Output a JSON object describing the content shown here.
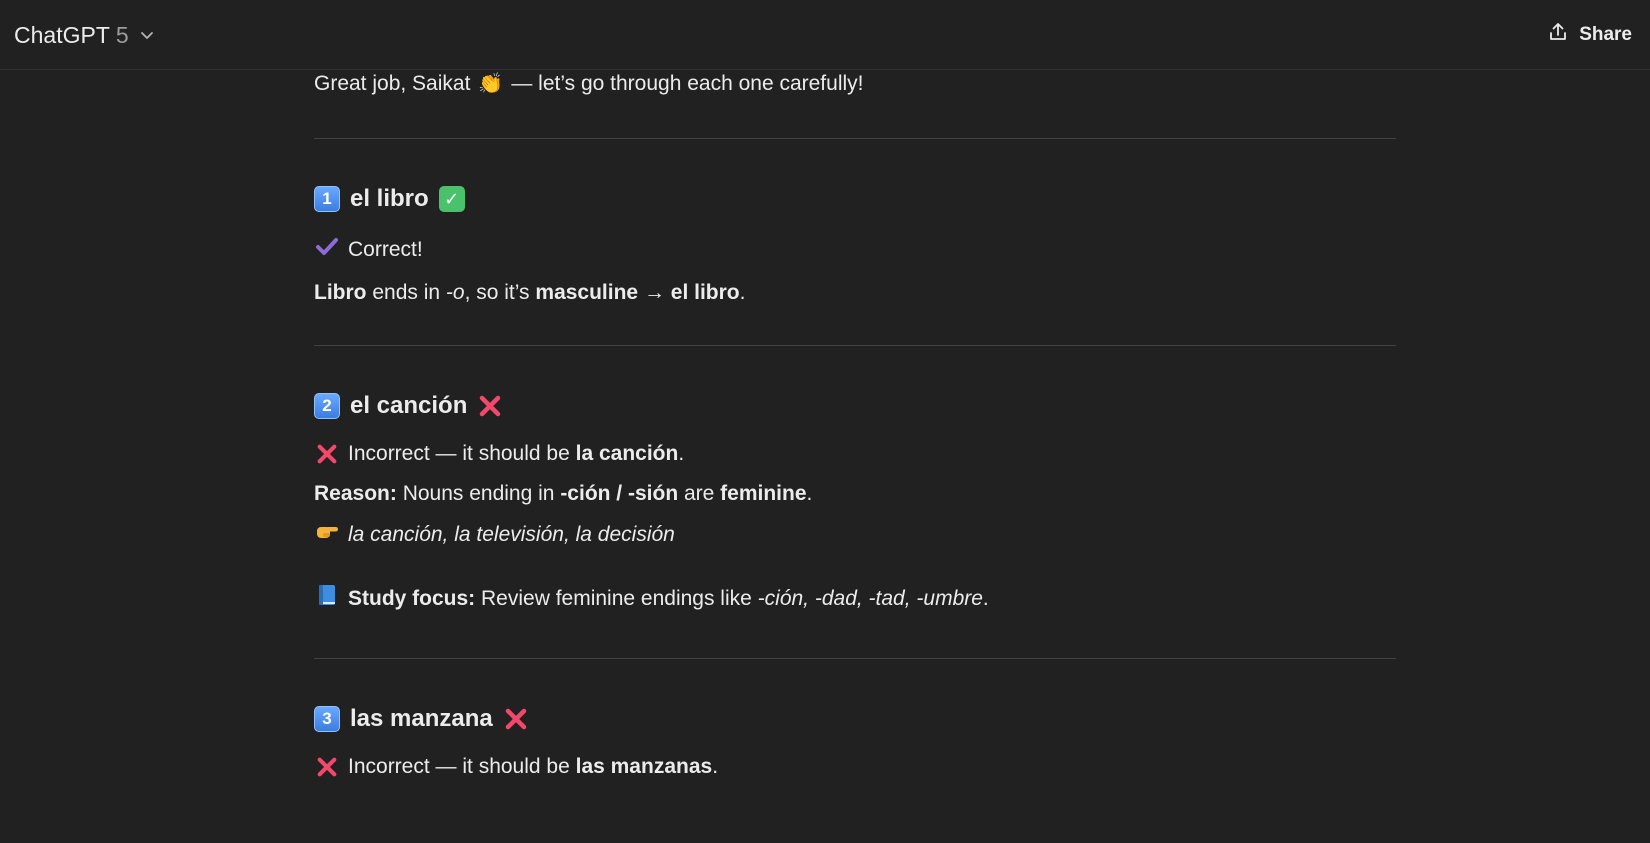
{
  "header": {
    "model_name": "ChatGPT",
    "model_version": "5",
    "share_label": "Share"
  },
  "message": {
    "intro_before": "Great job, Saikat",
    "intro_emoji": "👏",
    "intro_after": "— let’s go through each one carefully!",
    "items": [
      {
        "number": "1",
        "title": "el libro",
        "verdict": "Correct!",
        "explain_bold1": "Libro",
        "explain_mid1": " ends in ",
        "explain_em1": "-o",
        "explain_mid2": ", so it’s ",
        "explain_bold2": "masculine → el libro",
        "explain_end": "."
      },
      {
        "number": "2",
        "title": "el canción",
        "verdict_prefix": "Incorrect — it should be ",
        "verdict_bold": "la canción",
        "verdict_end": ".",
        "reason_label": "Reason:",
        "reason_mid1": " Nouns ending in ",
        "reason_bold1": "-ción / -sión",
        "reason_mid2": " are ",
        "reason_bold2": "feminine",
        "reason_end": ".",
        "examples": "la canción, la televisión, la decisión",
        "study_label": "Study focus:",
        "study_mid": " Review feminine endings like ",
        "study_em": "-ción, -dad, -tad, -umbre",
        "study_end": "."
      },
      {
        "number": "3",
        "title": "las manzana",
        "verdict_prefix": "Incorrect — it should be ",
        "verdict_bold": "las manzanas",
        "verdict_end": "."
      }
    ]
  },
  "colors": {
    "background": "#212121",
    "text": "#ececec",
    "divider": "#424242",
    "keycap_blue": "#3b7dde",
    "check_green": "#49c26b",
    "cross_red": "#f2486b",
    "checkmark_purple": "#8b6cd9"
  },
  "icons": [
    "chevron-down-icon",
    "share-icon",
    "clapping-hands-icon",
    "keycap-1-icon",
    "keycap-2-icon",
    "keycap-3-icon",
    "check-box-icon",
    "check-mark-icon",
    "cross-mark-icon",
    "pointing-hand-icon",
    "blue-book-icon"
  ]
}
